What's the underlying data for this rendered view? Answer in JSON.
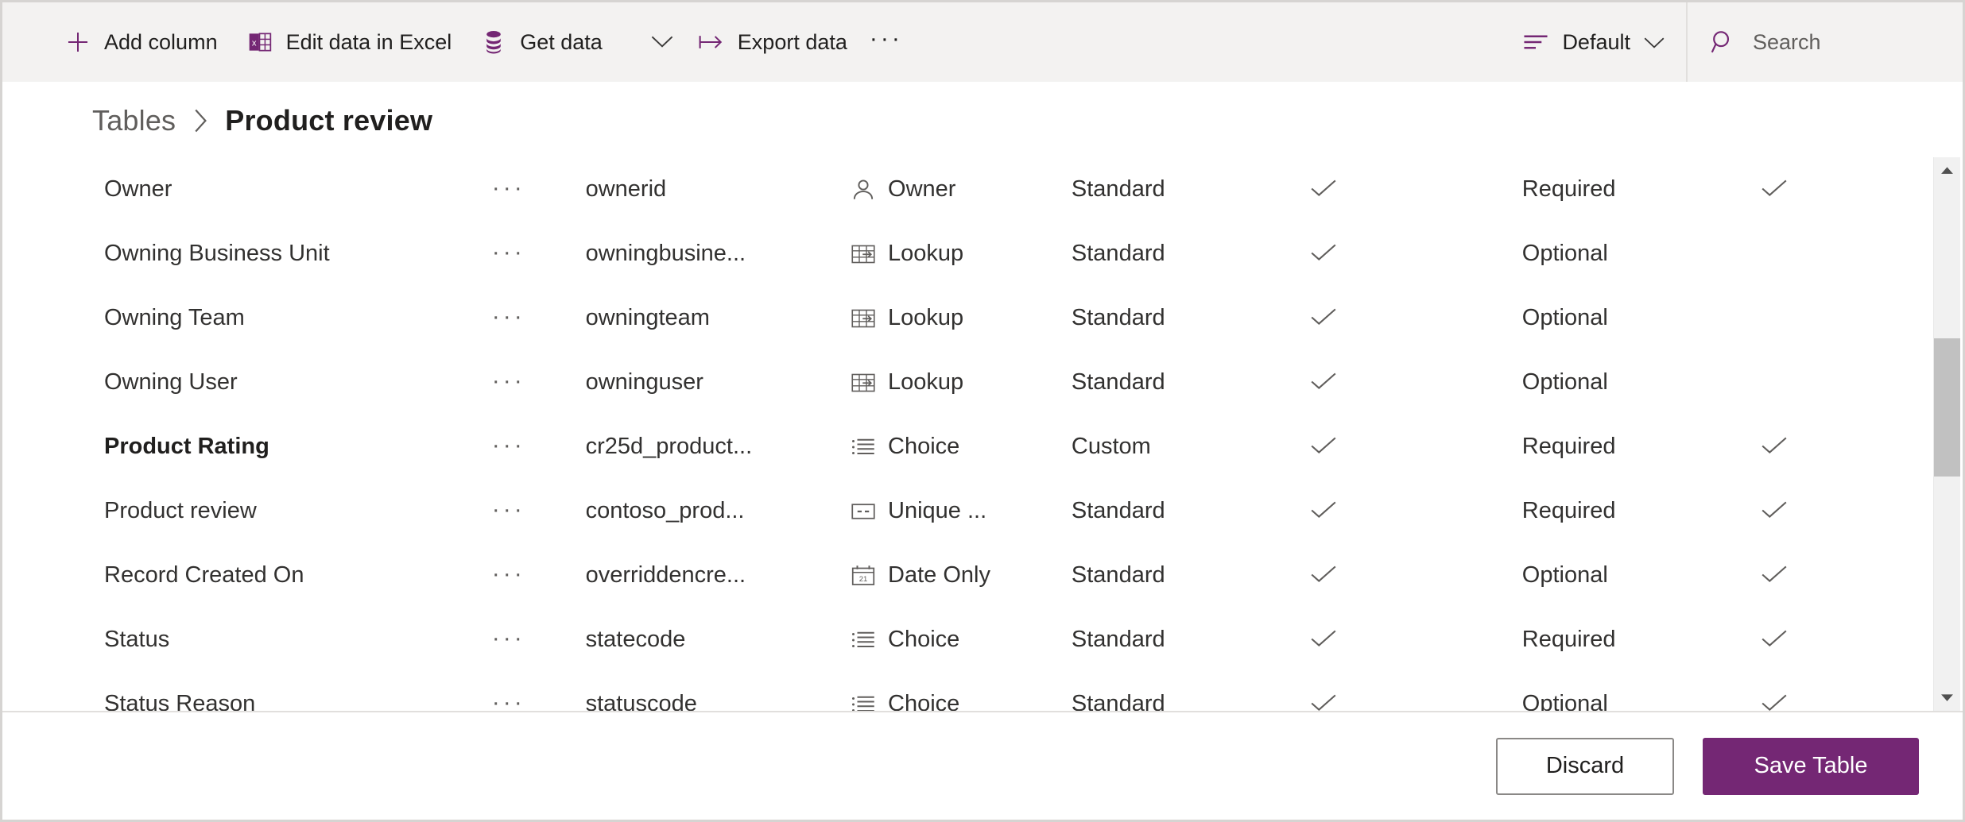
{
  "accent_color": "#742774",
  "toolbar": {
    "add_column": "Add column",
    "edit_excel": "Edit data in Excel",
    "get_data": "Get data",
    "export_data": "Export data",
    "overflow": "···",
    "view_label": "Default",
    "search_placeholder": "Search",
    "search_value": ""
  },
  "breadcrumb": {
    "parent": "Tables",
    "separator": "›",
    "current": "Product review"
  },
  "grid": {
    "rows": [
      {
        "display_name": "Owner",
        "bold": false,
        "menu": "···",
        "logical_name": "ownerid",
        "data_type": "Owner",
        "type_icon": "person-icon",
        "customization": "Standard",
        "searchable_check": "✓",
        "requirement": "Required",
        "required_check": "✓"
      },
      {
        "display_name": "Owning Business Unit",
        "bold": false,
        "menu": "···",
        "logical_name": "owningbusine...",
        "data_type": "Lookup",
        "type_icon": "lookup-icon",
        "customization": "Standard",
        "searchable_check": "✓",
        "requirement": "Optional",
        "required_check": ""
      },
      {
        "display_name": "Owning Team",
        "bold": false,
        "menu": "···",
        "logical_name": "owningteam",
        "data_type": "Lookup",
        "type_icon": "lookup-icon",
        "customization": "Standard",
        "searchable_check": "✓",
        "requirement": "Optional",
        "required_check": ""
      },
      {
        "display_name": "Owning User",
        "bold": false,
        "menu": "···",
        "logical_name": "owninguser",
        "data_type": "Lookup",
        "type_icon": "lookup-icon",
        "customization": "Standard",
        "searchable_check": "✓",
        "requirement": "Optional",
        "required_check": ""
      },
      {
        "display_name": "Product Rating",
        "bold": true,
        "menu": "···",
        "logical_name": "cr25d_product...",
        "data_type": "Choice",
        "type_icon": "choice-icon",
        "customization": "Custom",
        "searchable_check": "✓",
        "requirement": "Required",
        "required_check": "✓"
      },
      {
        "display_name": "Product review",
        "bold": false,
        "menu": "···",
        "logical_name": "contoso_prod...",
        "data_type": "Unique ...",
        "type_icon": "unique-id-icon",
        "customization": "Standard",
        "searchable_check": "✓",
        "requirement": "Required",
        "required_check": "✓"
      },
      {
        "display_name": "Record Created On",
        "bold": false,
        "menu": "···",
        "logical_name": "overriddencre...",
        "data_type": "Date Only",
        "type_icon": "calendar-icon",
        "customization": "Standard",
        "searchable_check": "✓",
        "requirement": "Optional",
        "required_check": "✓"
      },
      {
        "display_name": "Status",
        "bold": false,
        "menu": "···",
        "logical_name": "statecode",
        "data_type": "Choice",
        "type_icon": "choice-icon",
        "customization": "Standard",
        "searchable_check": "✓",
        "requirement": "Required",
        "required_check": "✓"
      },
      {
        "display_name": "Status Reason",
        "bold": false,
        "menu": "···",
        "logical_name": "statuscode",
        "data_type": "Choice",
        "type_icon": "choice-icon",
        "customization": "Standard",
        "searchable_check": "✓",
        "requirement": "Optional",
        "required_check": "✓"
      }
    ]
  },
  "footer": {
    "discard": "Discard",
    "save": "Save Table"
  }
}
